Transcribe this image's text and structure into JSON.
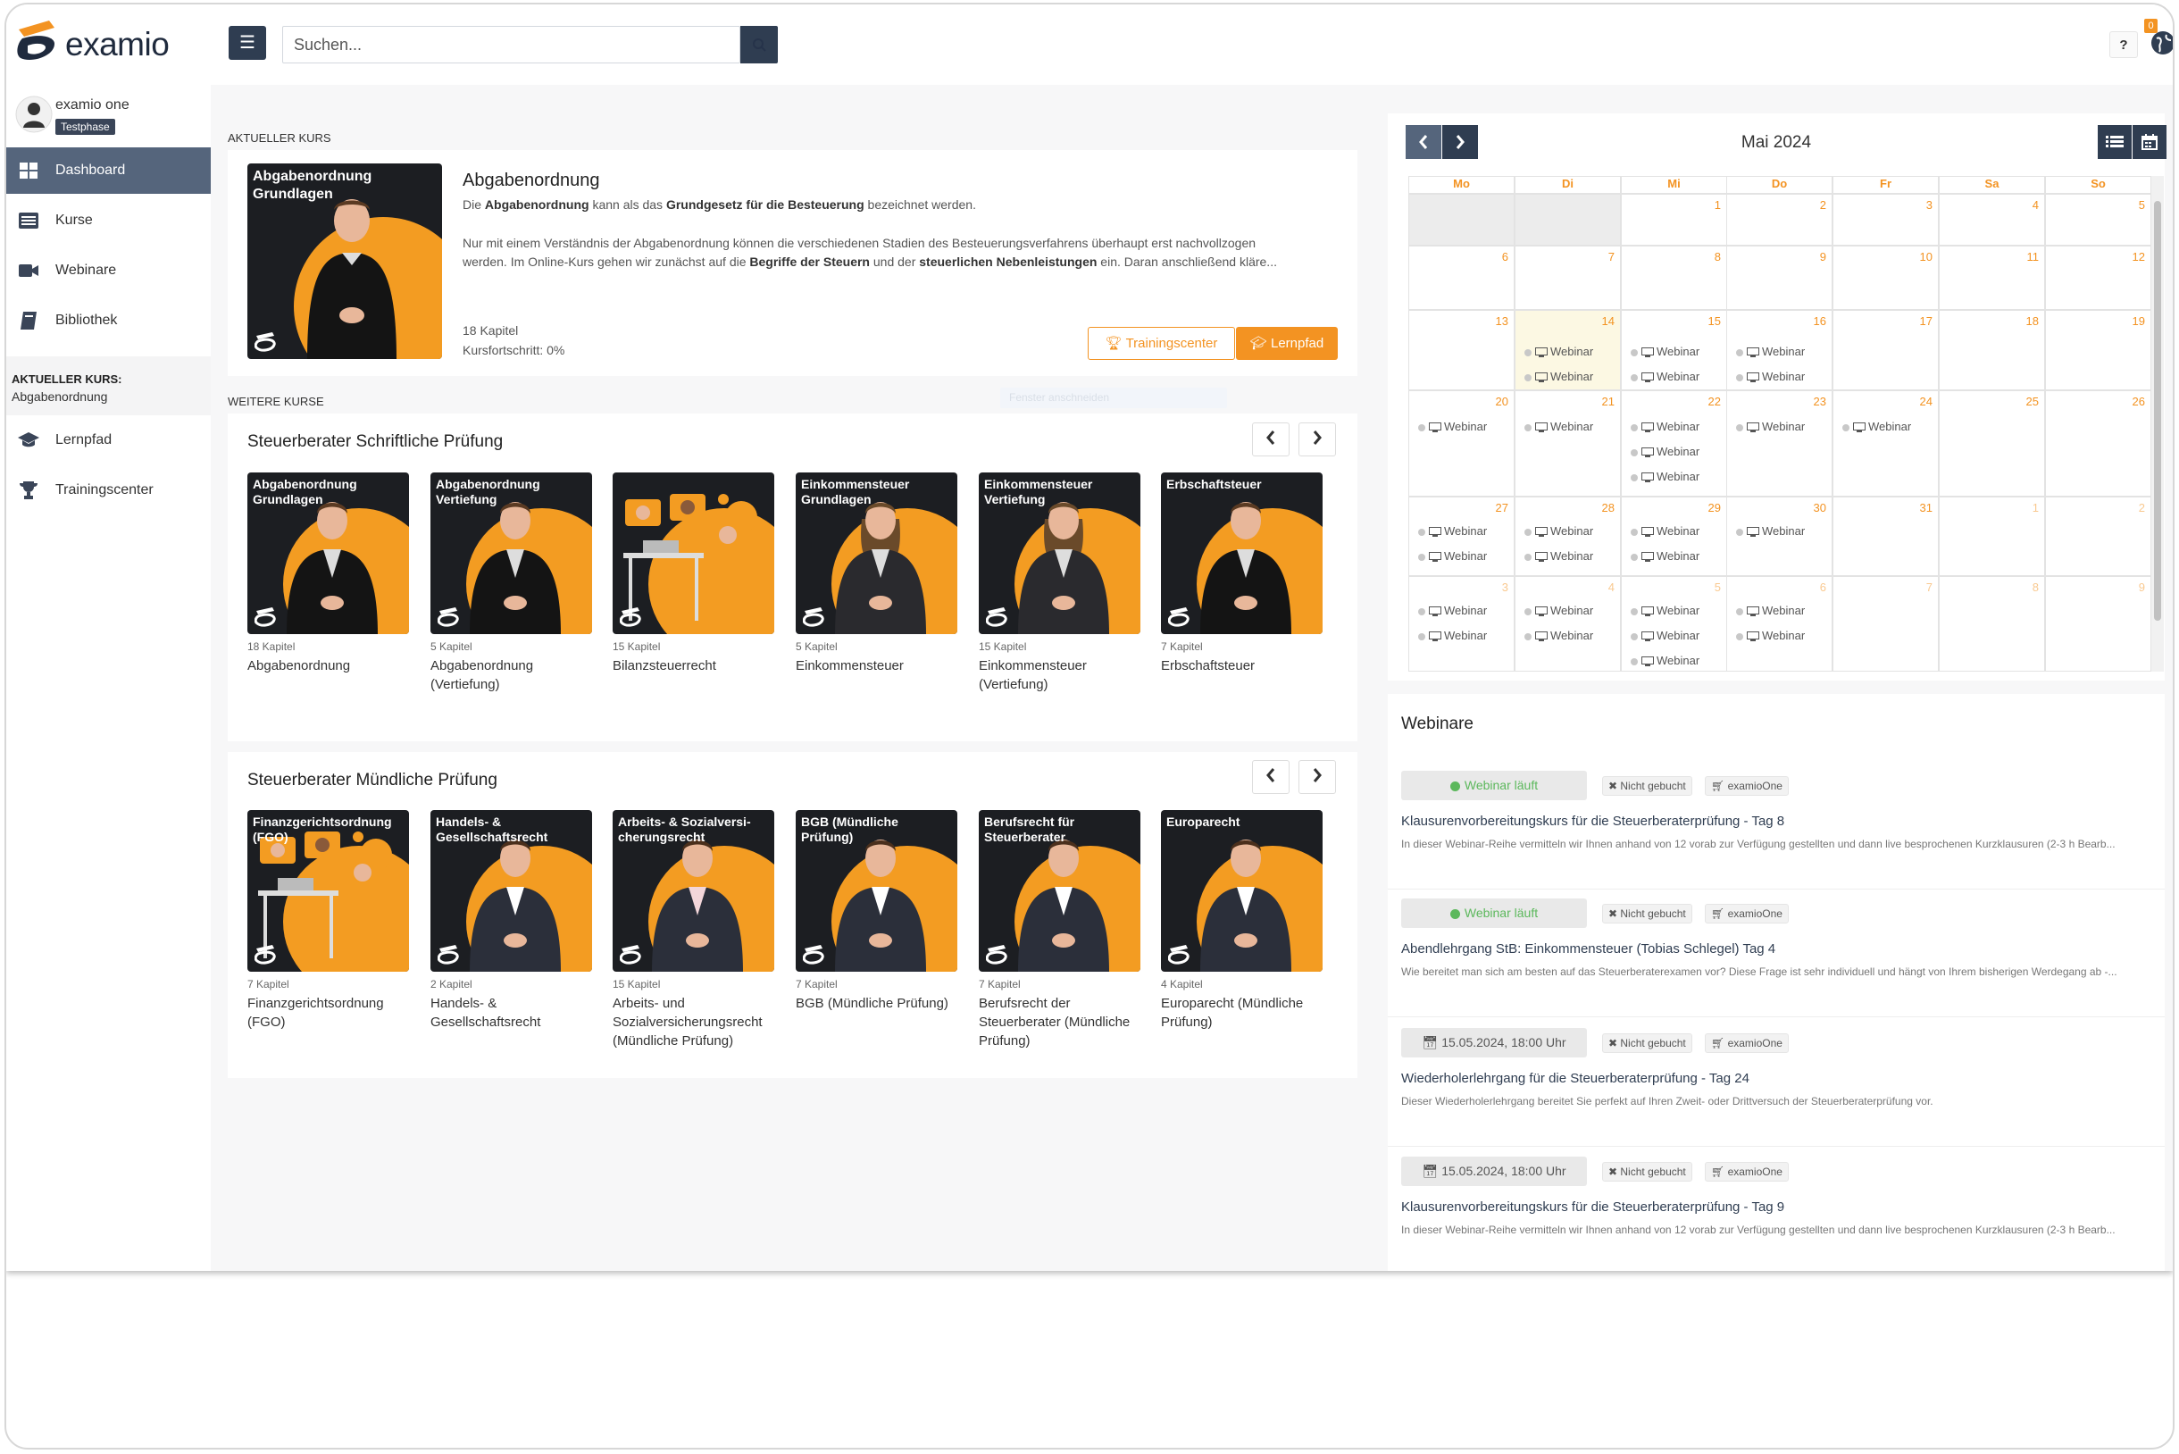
{
  "app": {
    "logo_text": "examio"
  },
  "search": {
    "placeholder": "Suchen..."
  },
  "topbar": {
    "help_label": "?",
    "notification_count": "0"
  },
  "user": {
    "name": "examio one",
    "badge": "Testphase"
  },
  "sidebar": {
    "items": [
      {
        "label": "Dashboard"
      },
      {
        "label": "Kurse"
      },
      {
        "label": "Webinare"
      },
      {
        "label": "Bibliothek"
      },
      {
        "label": "Lernpfad"
      },
      {
        "label": "Trainingscenter"
      }
    ],
    "current_course_label": "AKTUELLER KURS:",
    "current_course_value": "Abgabenordnung"
  },
  "current_course": {
    "section_label": "AKTUELLER KURS",
    "thumb_title": "Abgabenordnung Grundlagen",
    "title": "Abgabenordnung",
    "text1_pre": "Die ",
    "text1_b1": "Abgabenordnung",
    "text1_mid": " kann als das ",
    "text1_b2": "Grundgesetz für die Besteuerung",
    "text1_post": " bezeichnet werden.",
    "text2_line1": "Nur mit einem Verständnis der Abgabenordnung können die verschiedenen Stadien des Besteuerungsverfahrens überhaupt erst nachvollzogen",
    "text2_pre": "werden. Im Online-Kurs gehen wir zunächst auf die ",
    "text2_b1": "Begriffe der Steuern",
    "text2_mid": " und der ",
    "text2_b2": "steuerlichen Nebenleistungen",
    "text2_post": " ein. Daran anschließend kläre...",
    "chapters": "18 Kapitel",
    "progress": "Kursfortschritt: 0%",
    "btn_training": "Trainingscenter",
    "btn_lernpfad": "Lernpfad"
  },
  "further_label": "WEITERE KURSE",
  "ghost_text": "Fenster anschneiden",
  "panels": [
    {
      "title": "Steuerberater Schriftliche Prüfung",
      "courses": [
        {
          "thumb": "Abgabenordnung Grundlagen",
          "chapters": "18 Kapitel",
          "name": "Abgabenordnung"
        },
        {
          "thumb": "Abgabenordnung Vertiefung",
          "chapters": "5 Kapitel",
          "name": "Abgabenordnung (Vertiefung)"
        },
        {
          "thumb": "",
          "chapters": "15 Kapitel",
          "name": "Bilanzsteuerrecht"
        },
        {
          "thumb": "Einkommensteuer Grundlagen",
          "chapters": "5 Kapitel",
          "name": "Einkommensteuer"
        },
        {
          "thumb": "Einkommensteuer Vertiefung",
          "chapters": "15 Kapitel",
          "name": "Einkommensteuer (Vertiefung)"
        },
        {
          "thumb": "Erbschaftsteuer",
          "chapters": "7 Kapitel",
          "name": "Erbschaftsteuer"
        }
      ]
    },
    {
      "title": "Steuerberater Mündliche Prüfung",
      "courses": [
        {
          "thumb": "Finanzgerichtsordnung (FGO)",
          "chapters": "7 Kapitel",
          "name": "Finanzgerichtsordnung (FGO)"
        },
        {
          "thumb": "Handels- & Gesellschaftsrecht",
          "chapters": "2 Kapitel",
          "name": "Handels- & Gesellschaftsrecht"
        },
        {
          "thumb": "Arbeits- & Sozialversi-cherungsrecht",
          "chapters": "15 Kapitel",
          "name": "Arbeits- und Sozialversicherungsrecht (Mündliche Prüfung)"
        },
        {
          "thumb": "BGB (Mündliche Prüfung)",
          "chapters": "7 Kapitel",
          "name": "BGB (Mündliche Prüfung)"
        },
        {
          "thumb": "Berufsrecht für Steuerberater",
          "chapters": "7 Kapitel",
          "name": "Berufsrecht der Steuerberater (Mündliche Prüfung)"
        },
        {
          "thumb": "Europarecht",
          "chapters": "4 Kapitel",
          "name": "Europarecht (Mündliche Prüfung)"
        }
      ]
    }
  ],
  "calendar": {
    "title": "Mai 2024",
    "weekdays": [
      "Mo",
      "Di",
      "Mi",
      "Do",
      "Fr",
      "Sa",
      "So"
    ],
    "event_label": "Webinar",
    "weeks": [
      [
        {
          "d": ""
        },
        {
          "d": ""
        },
        {
          "d": "1"
        },
        {
          "d": "2"
        },
        {
          "d": "3"
        },
        {
          "d": "4"
        },
        {
          "d": "5"
        }
      ],
      [
        {
          "d": "6"
        },
        {
          "d": "7"
        },
        {
          "d": "8"
        },
        {
          "d": "9"
        },
        {
          "d": "10"
        },
        {
          "d": "11"
        },
        {
          "d": "12"
        }
      ],
      [
        {
          "d": "13"
        },
        {
          "d": "14",
          "ev": 2
        },
        {
          "d": "15",
          "ev": 2
        },
        {
          "d": "16",
          "ev": 2
        },
        {
          "d": "17"
        },
        {
          "d": "18"
        },
        {
          "d": "19"
        }
      ],
      [
        {
          "d": "20",
          "ev": 1
        },
        {
          "d": "21",
          "ev": 1
        },
        {
          "d": "22",
          "ev": 3
        },
        {
          "d": "23",
          "ev": 1
        },
        {
          "d": "24",
          "ev": 1
        },
        {
          "d": "25"
        },
        {
          "d": "26"
        }
      ],
      [
        {
          "d": "27",
          "ev": 2
        },
        {
          "d": "28",
          "ev": 2
        },
        {
          "d": "29",
          "ev": 2
        },
        {
          "d": "30",
          "ev": 1
        },
        {
          "d": "31"
        },
        {
          "d": "1",
          "o": true
        },
        {
          "d": "2",
          "o": true
        }
      ],
      [
        {
          "d": "3",
          "o": true,
          "ev": 2
        },
        {
          "d": "4",
          "o": true,
          "ev": 2
        },
        {
          "d": "5",
          "o": true,
          "ev": 3
        },
        {
          "d": "6",
          "o": true,
          "ev": 2
        },
        {
          "d": "7",
          "o": true
        },
        {
          "d": "8",
          "o": true
        },
        {
          "d": "9",
          "o": true
        }
      ]
    ]
  },
  "webinars": {
    "title": "Webinare",
    "items": [
      {
        "status": "Webinar läuft",
        "live": true,
        "tag1": "Nicht gebucht",
        "tag2": "examioOne",
        "name": "Klausurenvorbereitungskurs für die Steuerberaterprüfung - Tag 8",
        "desc": "In dieser Webinar-Reihe vermitteln wir Ihnen anhand von 12 vorab zur Verfügung gestellten und dann live besprochenen Kurzklausuren (2-3 h Bearb..."
      },
      {
        "status": "Webinar läuft",
        "live": true,
        "tag1": "Nicht gebucht",
        "tag2": "examioOne",
        "name": "Abendlehrgang StB: Einkommensteuer (Tobias Schlegel) Tag 4",
        "desc": "Wie bereitet man sich am besten auf das Steuerberaterexamen vor? Diese Frage ist sehr individuell und hängt von Ihrem bisherigen Werdegang ab -..."
      },
      {
        "status": "15.05.2024, 18:00 Uhr",
        "live": false,
        "tag1": "Nicht gebucht",
        "tag2": "examioOne",
        "name": "Wiederholerlehrgang für die Steuerberaterprüfung - Tag 24",
        "desc": "Dieser Wiederholerlehrgang bereitet Sie perfekt auf Ihren Zweit- oder Drittversuch der Steuerberaterprüfung vor."
      },
      {
        "status": "15.05.2024, 18:00 Uhr",
        "live": false,
        "tag1": "Nicht gebucht",
        "tag2": "examioOne",
        "name": "Klausurenvorbereitungskurs für die Steuerberaterprüfung - Tag 9",
        "desc": "In dieser Webinar-Reihe vermitteln wir Ihnen anhand von 12 vorab zur Verfügung gestellten und dann live besprochenen Kurzklausuren (2-3 h Bearb..."
      }
    ]
  },
  "colors": {
    "accent": "#f39322",
    "dark": "#2f3d51",
    "live": "#5cb85c"
  }
}
